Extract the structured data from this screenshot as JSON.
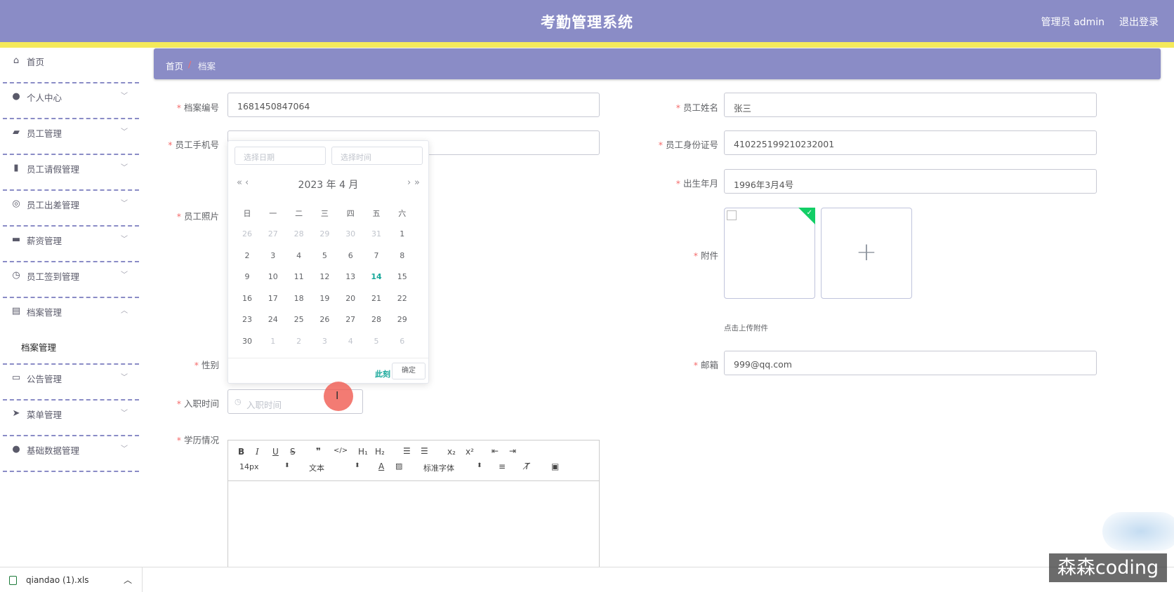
{
  "header": {
    "title": "考勤管理系统",
    "user": "管理员 admin",
    "logout": "退出登录"
  },
  "sidebar": {
    "items": [
      {
        "label": "首页",
        "icon": "home-icon"
      },
      {
        "label": "个人中心",
        "icon": "user-icon"
      },
      {
        "label": "员工管理",
        "icon": "briefcase-icon"
      },
      {
        "label": "员工请假管理",
        "icon": "bar-chart-icon"
      },
      {
        "label": "员工出差管理",
        "icon": "lifebuoy-icon"
      },
      {
        "label": "薪资管理",
        "icon": "toolbox-icon"
      },
      {
        "label": "员工签到管理",
        "icon": "clock-icon"
      },
      {
        "label": "档案管理",
        "icon": "clipboard-icon",
        "sub": "档案管理"
      },
      {
        "label": "公告管理",
        "icon": "monitor-icon"
      },
      {
        "label": "菜单管理",
        "icon": "send-icon"
      },
      {
        "label": "基础数据管理",
        "icon": "user-icon"
      }
    ]
  },
  "breadcrumb": {
    "home": "首页",
    "sep": "/",
    "current": "档案"
  },
  "form": {
    "archive_no": {
      "label": "档案编号",
      "value": "1681450847064"
    },
    "name": {
      "label": "员工姓名",
      "value": "张三"
    },
    "phone": {
      "label": "员工手机号"
    },
    "idcard": {
      "label": "员工身份证号",
      "value": "410225199210232001"
    },
    "birth": {
      "label": "出生年月",
      "value": "1996年3月4号"
    },
    "photo": {
      "label": "员工照片"
    },
    "attach": {
      "label": "附件",
      "hint": "点击上传附件"
    },
    "gender": {
      "label": "性别"
    },
    "email": {
      "label": "邮箱",
      "value": "999@qq.com"
    },
    "join": {
      "label": "入职时间",
      "placeholder": "入职时间"
    },
    "edu": {
      "label": "学历情况"
    }
  },
  "datepicker": {
    "date_placeholder": "选择日期",
    "time_placeholder": "选择时间",
    "header": "2023 年  4 月",
    "weekdays": [
      "日",
      "一",
      "二",
      "三",
      "四",
      "五",
      "六"
    ],
    "weeks": [
      [
        "26",
        "27",
        "28",
        "29",
        "30",
        "31",
        "1"
      ],
      [
        "2",
        "3",
        "4",
        "5",
        "6",
        "7",
        "8"
      ],
      [
        "9",
        "10",
        "11",
        "12",
        "13",
        "14",
        "15"
      ],
      [
        "16",
        "17",
        "18",
        "19",
        "20",
        "21",
        "22"
      ],
      [
        "23",
        "24",
        "25",
        "26",
        "27",
        "28",
        "29"
      ],
      [
        "30",
        "1",
        "2",
        "3",
        "4",
        "5",
        "6"
      ]
    ],
    "today": "14",
    "now": "此刻",
    "ok": "确定"
  },
  "editor": {
    "font_size": "14px",
    "block": "文本",
    "font": "标准字体"
  },
  "downloads": {
    "file": "qiandao (1).xls"
  },
  "watermark": "森森coding"
}
